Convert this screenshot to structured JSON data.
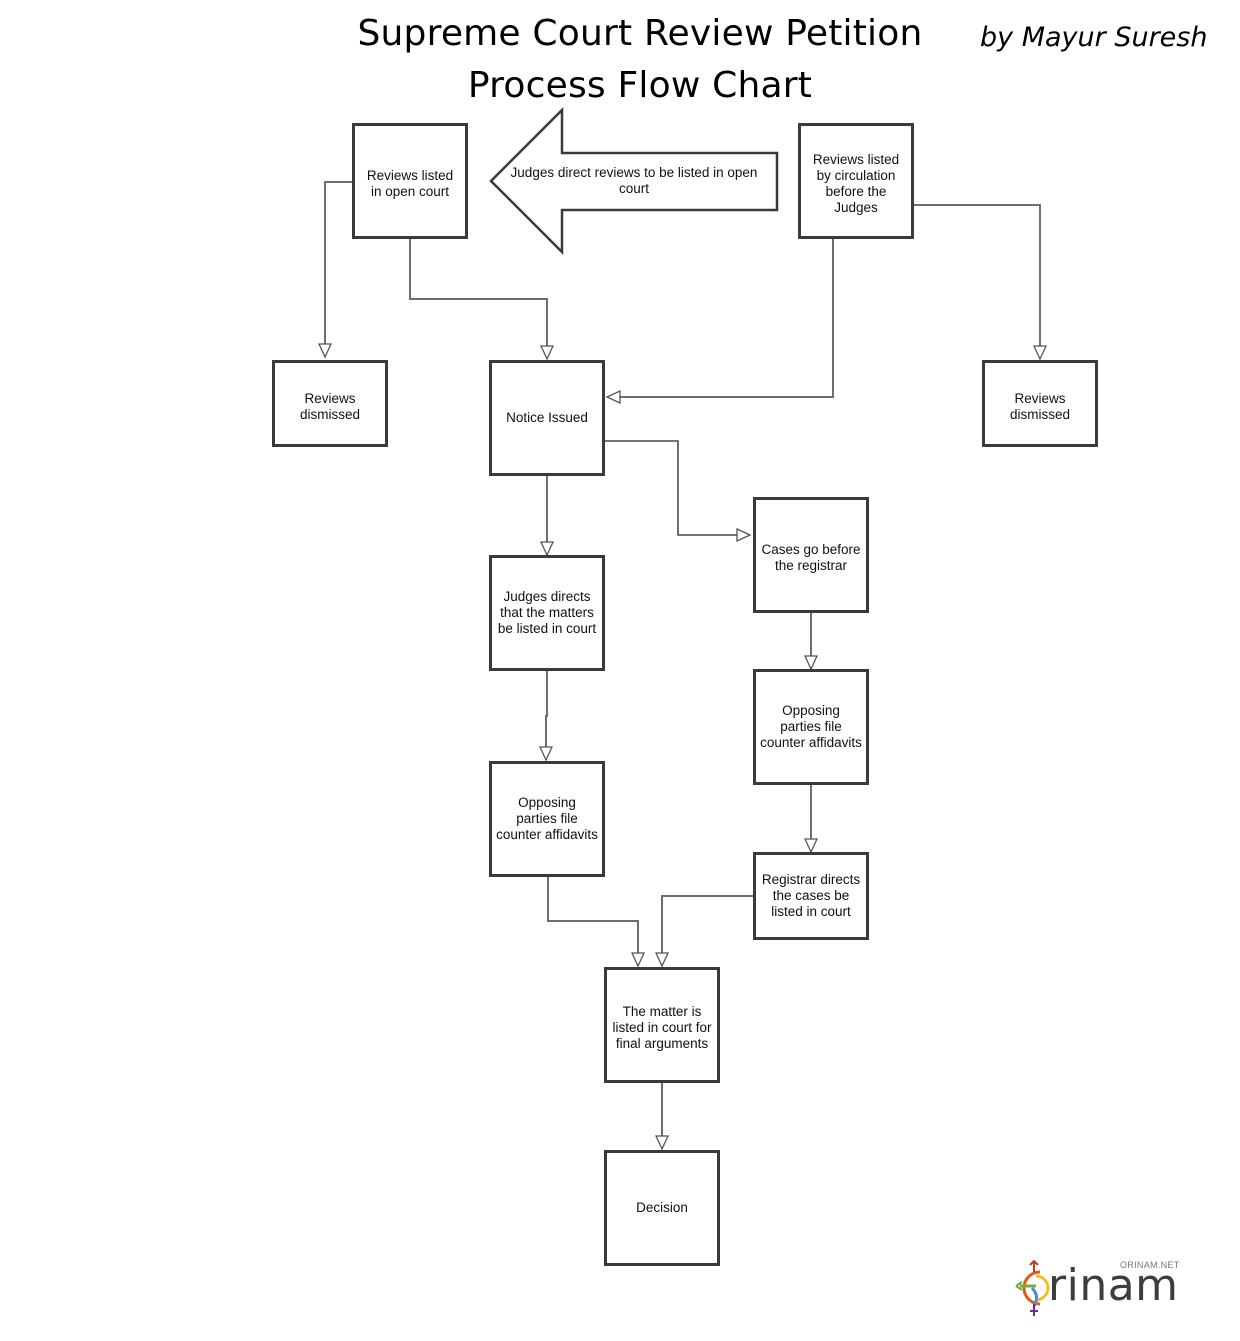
{
  "title": {
    "line1": "Supreme Court Review Petition",
    "line2": "Process Flow Chart"
  },
  "author": "by Mayur Suresh",
  "nodes": {
    "open_court": "Reviews listed\nin open court",
    "circulation": "Reviews listed\nby circulation\nbefore the\nJudges",
    "dismissed_left": "Reviews\ndismissed",
    "notice": "Notice Issued",
    "dismissed_right": "Reviews\ndismissed",
    "judges_direct": "Judges directs\nthat the matters\nbe listed in court",
    "registrar": "Cases go before\nthe registrar",
    "counter_left": "Opposing\nparties file\ncounter affidavits",
    "counter_right": "Opposing\nparties file\ncounter affidavits",
    "registrar_directs": "Registrar directs\nthe cases be\nlisted in court",
    "final_args": "The matter is\nlisted in court for\nfinal arguments",
    "decision": "Decision"
  },
  "big_arrow_label": "Judges direct reviews to be listed in open\ncourt",
  "edges": [
    {
      "from": "circulation",
      "to": "open_court",
      "label": "Judges direct reviews to be listed in open court"
    },
    {
      "from": "open_court",
      "to": "dismissed_left"
    },
    {
      "from": "open_court",
      "to": "notice"
    },
    {
      "from": "circulation",
      "to": "notice"
    },
    {
      "from": "circulation",
      "to": "dismissed_right"
    },
    {
      "from": "notice",
      "to": "judges_direct"
    },
    {
      "from": "notice",
      "to": "registrar"
    },
    {
      "from": "judges_direct",
      "to": "counter_left"
    },
    {
      "from": "registrar",
      "to": "counter_right"
    },
    {
      "from": "counter_right",
      "to": "registrar_directs"
    },
    {
      "from": "counter_left",
      "to": "final_args"
    },
    {
      "from": "registrar_directs",
      "to": "final_args"
    },
    {
      "from": "final_args",
      "to": "decision"
    }
  ],
  "logo": {
    "word": "rinam",
    "site": "ORINAM.NET"
  }
}
